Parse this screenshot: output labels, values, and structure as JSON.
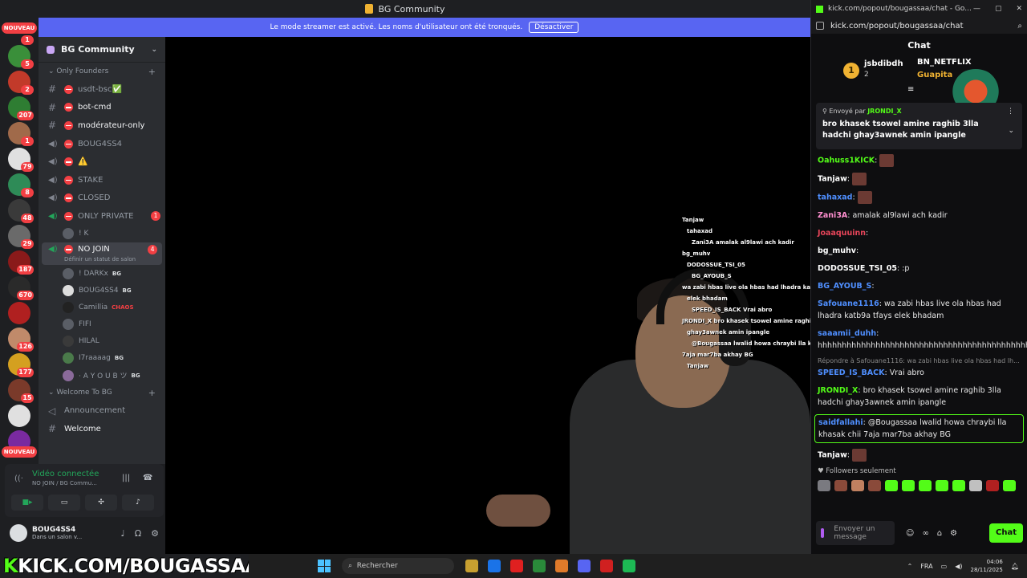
{
  "window": {
    "title": "BG Community"
  },
  "banner": {
    "text": "Le mode streamer est activé. Les noms d'utilisateur ont été tronqués.",
    "button": "Désactiver"
  },
  "rail": {
    "nouveau_top": "NOUVEAU",
    "nouveau_bottom": "NOUVEAU",
    "badges": [
      "1",
      "5",
      "2",
      "207",
      "1",
      "79",
      "8",
      "48",
      "29",
      "187",
      "670",
      "126",
      "177",
      "15"
    ]
  },
  "server": {
    "name": "BG Community",
    "categories": {
      "only_founders": "Only Founders",
      "welcome": "Welcome To BG"
    },
    "channels": [
      {
        "name": "usdt-bsc✅",
        "kind": "text"
      },
      {
        "name": "bot-cmd",
        "kind": "text"
      },
      {
        "name": "modérateur-only",
        "kind": "text"
      },
      {
        "name": "BOUG4SS4",
        "kind": "voice"
      },
      {
        "name": "⚠️",
        "kind": "voice"
      },
      {
        "name": "STAKE",
        "kind": "voice"
      },
      {
        "name": "CLOSED",
        "kind": "voice"
      },
      {
        "name": "ONLY PRIVATE",
        "kind": "voice",
        "count": "1"
      }
    ],
    "only_private_user": "! K",
    "active_channel": {
      "name": "NO JOIN",
      "count": "4",
      "subtitle": "Définir un statut de salon"
    },
    "voice_users": [
      {
        "name": "! DARKx",
        "tag": "BG"
      },
      {
        "name": "BOUG4SS4",
        "tag": "BG"
      },
      {
        "name": "Camillia",
        "tag": "CHAOS"
      },
      {
        "name": "FIFI",
        "tag": ""
      },
      {
        "name": "HILAL",
        "tag": ""
      },
      {
        "name": "I7raaaag",
        "tag": "BG"
      },
      {
        "name": "· A Y O U B ツ",
        "tag": "BG"
      }
    ],
    "welcome_channels": [
      {
        "name": "Announcement",
        "kind": "announce"
      },
      {
        "name": "Welcome",
        "kind": "text"
      }
    ]
  },
  "voice_panel": {
    "status": "Vidéo connectée",
    "location": "NO JOIN / BG Commu..."
  },
  "user_panel": {
    "name": "BOUG4SS4",
    "status": "Dans un salon v..."
  },
  "watermark": {
    "prefix": "K",
    "text": "KICK.COM/BOUGASSAA"
  },
  "taskbar": {
    "search_placeholder": "Rechercher",
    "lang": "FRA",
    "time": "04:06",
    "date": "28/11/2025",
    "app_colors": [
      "#c8a030",
      "#1a73e8",
      "#e02020",
      "#2a8a3a",
      "#e07a2a",
      "#5865f2",
      "#d02020",
      "#1db954"
    ]
  },
  "kick": {
    "window_title": "kick.com/popout/bougassaa/chat - Go...",
    "url": "kick.com/popout/bougassaa/chat",
    "chat_title": "Chat",
    "leaderboard": [
      {
        "rank": "1",
        "name": "jsbdibdh",
        "count": "2"
      },
      {
        "name": "BN_NETFLIX",
        "count": ""
      },
      {
        "name": "Guapita",
        "count": "1"
      }
    ],
    "pinned": {
      "label": "Envoyé par",
      "by": "JRONDI_X",
      "text": "bro khasek tsowel amine raghib 3lla hadchi ghay3awnek amin ipangle"
    },
    "messages": [
      {
        "user": "Oahuss1KICK",
        "color": "#53fc18",
        "text": "",
        "emote": true
      },
      {
        "user": "Tanjaw",
        "color": "#ffffff",
        "text": "",
        "emote": true
      },
      {
        "user": "tahaxad",
        "color": "#4f8fff",
        "text": "",
        "emote": true
      },
      {
        "user": "Zani3A",
        "color": "#ff8fd0",
        "text": "amalak al9lawi ach kadir"
      },
      {
        "user": "Joaaquuinn",
        "color": "#e8455a",
        "text": ""
      },
      {
        "user": "bg_muhv",
        "color": "#ffffff",
        "text": ""
      },
      {
        "user": "DODOSSUE_TSI_05",
        "color": "#ffffff",
        "text": ":p"
      },
      {
        "user": "BG_AYOUB_S",
        "color": "#4f8fff",
        "text": ""
      },
      {
        "user": "Safouane1116",
        "color": "#4f8fff",
        "text": "wa zabi hbas live ola hbas had lhadra katb9a tfays elek bhadam"
      },
      {
        "user": "saaamii_duhh",
        "color": "#4f8fff",
        "text": "hhhhhhhhhhhhhhhhhhhhhhhhhhhhhhhhhhhhhhhhhhhhhhhhhhhhhhhhhhhhhhhhhhhh"
      },
      {
        "user": "SPEED_IS_BACK",
        "color": "#4f8fff",
        "text": "Vrai abro",
        "reply": "Répondre à Safouane1116: wa zabi hbas live ola hbas had lh..."
      },
      {
        "user": "JRONDI_X",
        "color": "#53fc18",
        "text": "bro khasek tsowel amine raghib 3lla hadchi ghay3awnek amin ipangle"
      },
      {
        "user": "saidfallahi",
        "color": "#4f8fff",
        "text": "@Bougassaa lwalid howa chraybi lla khasak chii 7aja mar7ba akhay BG",
        "highlight": true
      },
      {
        "user": "Tanjaw",
        "color": "#ffffff",
        "text": "",
        "emote": true
      }
    ],
    "followers_only": "Followers seulement",
    "input_placeholder": "Envoyer un message",
    "send_label": "Chat",
    "emote_colors": [
      "#7a7a80",
      "#8a4a3a",
      "#c08060",
      "#8a4a3a",
      "#53fc18",
      "#53fc18",
      "#53fc18",
      "#53fc18",
      "#53fc18",
      "#c0c0c0",
      "#b02020",
      "#53fc18"
    ]
  },
  "overlay": {
    "lines": [
      "Tanjaw",
      "tahaxad",
      "Zani3A  amalak al9lawi ach kadir",
      "bg_muhv",
      "DODOSSUE_TSI_05",
      "BG_AYOUB_S",
      "wa zabi hbas live ola hbas had lhadra katb9a tfays",
      "elek bhadam",
      "SPEED_IS_BACK  Vrai abro",
      "JRONDI_X  bro khasek tsowel amine raghib 3lla hadchi",
      "ghay3awnek amin ipangle",
      "@Bougassaa lwalid howa chraybi lla khasak chii",
      "7aja mar7ba akhay BG",
      "Tanjaw"
    ]
  }
}
